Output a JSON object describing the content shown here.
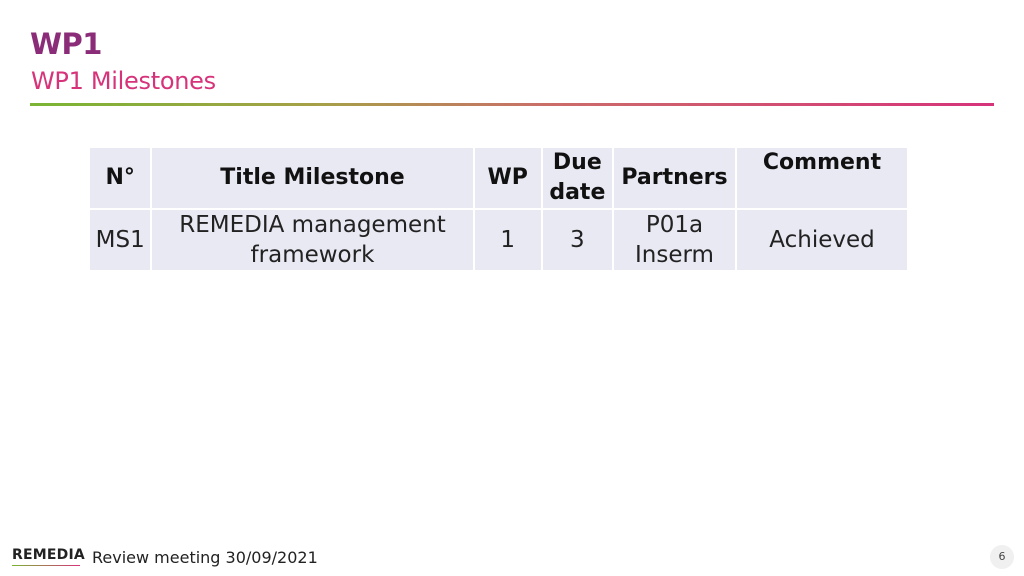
{
  "header": {
    "title": "WP1",
    "subtitle": "WP1 Milestones"
  },
  "colors": {
    "title": "#8b2c79",
    "subtitle": "#d6337a",
    "rule_start": "#7ab534",
    "rule_end": "#d6337a",
    "table_cell_bg": "#e9e9f4"
  },
  "table": {
    "headers": [
      "N°",
      "Title Milestone",
      "WP",
      "Due date",
      "Partners",
      "Comment"
    ],
    "header_lines": {
      "due_1": "Due",
      "due_2": "date"
    },
    "rows": [
      {
        "n": "MS1",
        "title_1": "REMEDIA management",
        "title_2": "framework",
        "wp": "1",
        "due": "3",
        "partners_1": "P01a",
        "partners_2": "Inserm",
        "comment": "Achieved"
      }
    ]
  },
  "footer": {
    "logo": "REMEDIA",
    "text": "Review meeting 30/09/2021",
    "page_number": "6"
  }
}
